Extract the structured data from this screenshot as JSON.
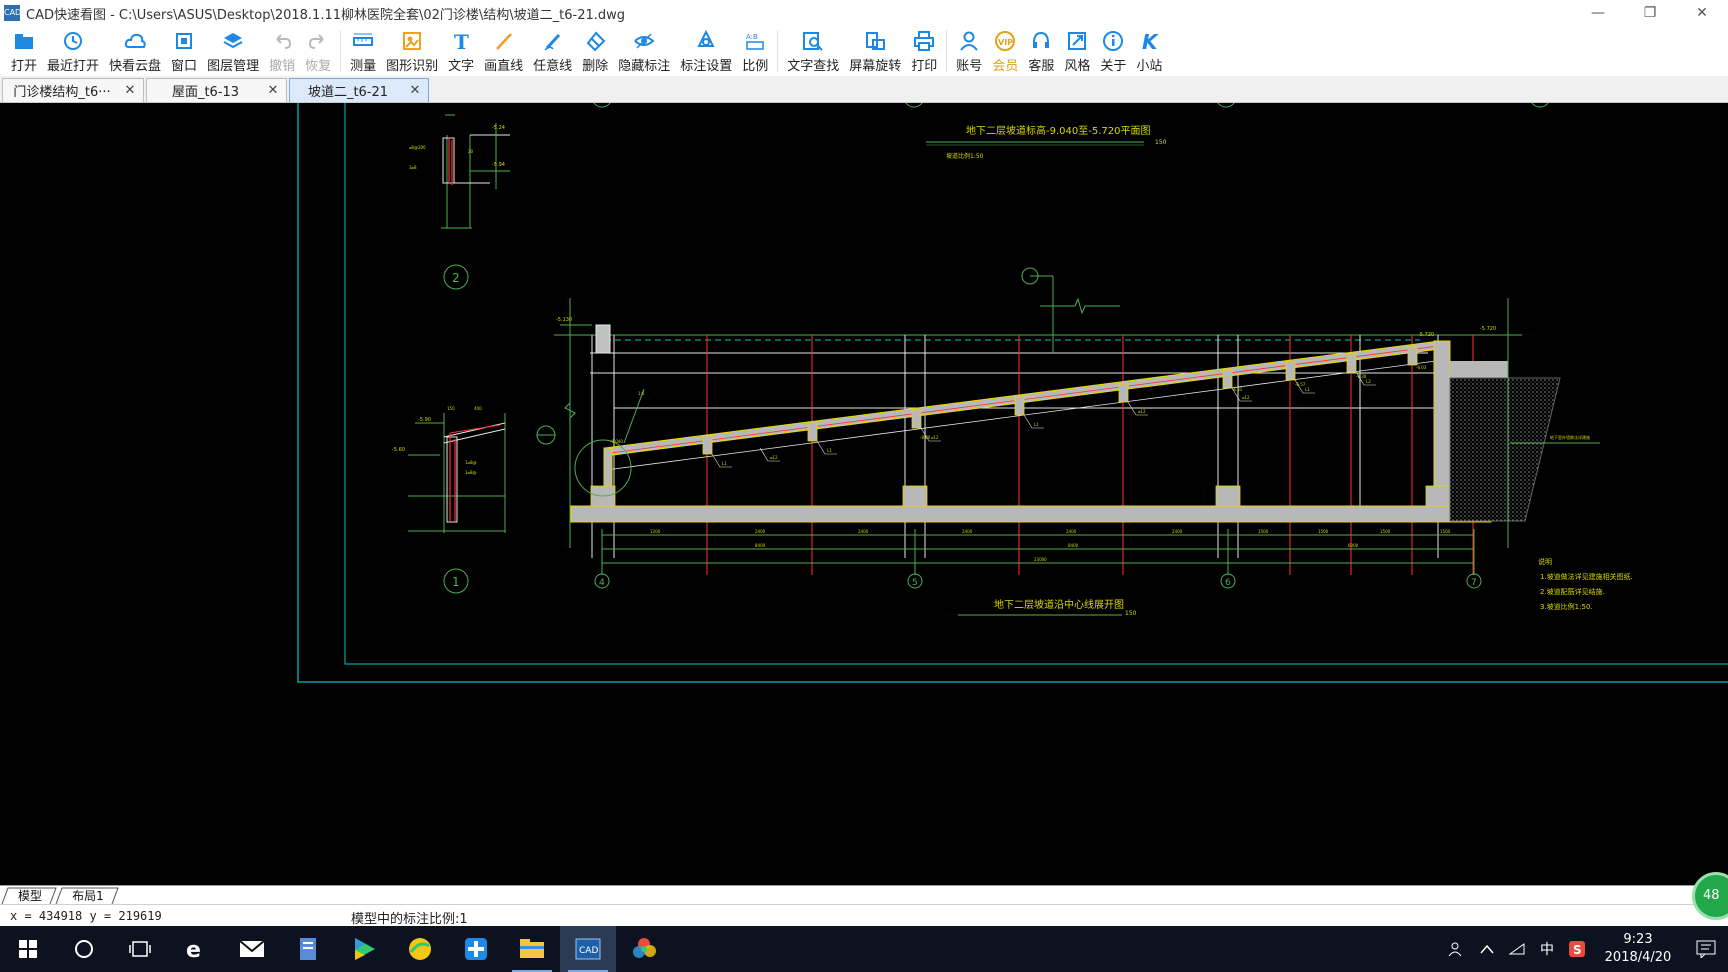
{
  "window": {
    "app_logo": "CAD",
    "title": "CAD快速看图 - C:\\Users\\ASUS\\Desktop\\2018.1.11柳林医院全套\\02门诊楼\\结构\\坡道二_t6-21.dwg",
    "minimize": "—",
    "restore": "❐",
    "close": "✕"
  },
  "toolbar": [
    {
      "label": "打开",
      "icon": "folder-icon",
      "color": "#1e88e5",
      "enabled": true
    },
    {
      "label": "最近打开",
      "icon": "history-icon",
      "color": "#1e88e5",
      "enabled": true
    },
    {
      "label": "快看云盘",
      "icon": "cloud-icon",
      "color": "#1e88e5",
      "enabled": true
    },
    {
      "label": "窗口",
      "icon": "window-icon",
      "color": "#1e88e5",
      "enabled": true
    },
    {
      "label": "图层管理",
      "icon": "layers-icon",
      "color": "#1e88e5",
      "enabled": true
    },
    {
      "label": "撤销",
      "icon": "undo-icon",
      "color": "#bbbbbb",
      "enabled": false
    },
    {
      "label": "恢复",
      "icon": "redo-icon",
      "color": "#bbbbbb",
      "enabled": false
    },
    {
      "label": "测量",
      "icon": "ruler-icon",
      "color": "#1e88e5",
      "enabled": true
    },
    {
      "label": "图形识别",
      "icon": "shape-recognize-icon",
      "color": "#f0a020",
      "enabled": true
    },
    {
      "label": "文字",
      "icon": "text-icon",
      "color": "#1e88e5",
      "enabled": true
    },
    {
      "label": "画直线",
      "icon": "line-icon",
      "color": "#f0a020",
      "enabled": true
    },
    {
      "label": "任意线",
      "icon": "pen-icon",
      "color": "#1e88e5",
      "enabled": true
    },
    {
      "label": "删除",
      "icon": "eraser-icon",
      "color": "#1e88e5",
      "enabled": true
    },
    {
      "label": "隐藏标注",
      "icon": "eye-hide-icon",
      "color": "#1e88e5",
      "enabled": true
    },
    {
      "label": "标注设置",
      "icon": "annotation-settings-icon",
      "color": "#1e88e5",
      "enabled": true
    },
    {
      "label": "比例",
      "icon": "scale-icon",
      "color": "#1e88e5",
      "enabled": true
    },
    {
      "label": "文字查找",
      "icon": "text-search-icon",
      "color": "#1e88e5",
      "enabled": true
    },
    {
      "label": "屏幕旋转",
      "icon": "rotate-screen-icon",
      "color": "#1e88e5",
      "enabled": true
    },
    {
      "label": "打印",
      "icon": "printer-icon",
      "color": "#1e88e5",
      "enabled": true
    },
    {
      "label": "账号",
      "icon": "user-icon",
      "color": "#1e88e5",
      "enabled": true
    },
    {
      "label": "会员",
      "icon": "vip-icon",
      "color": "#d9a520",
      "enabled": true
    },
    {
      "label": "客服",
      "icon": "headset-icon",
      "color": "#1e88e5",
      "enabled": true
    },
    {
      "label": "风格",
      "icon": "style-icon",
      "color": "#1e88e5",
      "enabled": true
    },
    {
      "label": "关于",
      "icon": "info-icon",
      "color": "#1e88e5",
      "enabled": true
    },
    {
      "label": "小站",
      "icon": "k-logo-icon",
      "color": "#1e88e5",
      "enabled": true
    }
  ],
  "tabs": [
    {
      "label": "门诊楼结构_t6···",
      "active": false
    },
    {
      "label": "屋面_t6-13",
      "active": false
    },
    {
      "label": "坡道二_t6-21",
      "active": true
    }
  ],
  "tab_close": "✕",
  "drawing": {
    "axis_labels": [
      "4",
      "5",
      "6",
      "7"
    ],
    "section_numbers": [
      "1",
      "2"
    ],
    "plan_title": "地下二层坡道标高-9.040至-5.720平面图",
    "section_title": "地下二层坡道沿中心线展开图",
    "notes_title": "说明",
    "notes": [
      "1.坡道做法详见建施相关图纸.",
      "2.坡道配筋详见结施.",
      "3.坡道比例1:50."
    ]
  },
  "layout_tabs": [
    "模型",
    "布局1"
  ],
  "status": {
    "coords": "x = 434918  y = 219619",
    "scale": "模型中的标注比例:1"
  },
  "badge": "48",
  "tray": {
    "ime": "中",
    "time": "9:23",
    "date": "2018/4/20"
  }
}
